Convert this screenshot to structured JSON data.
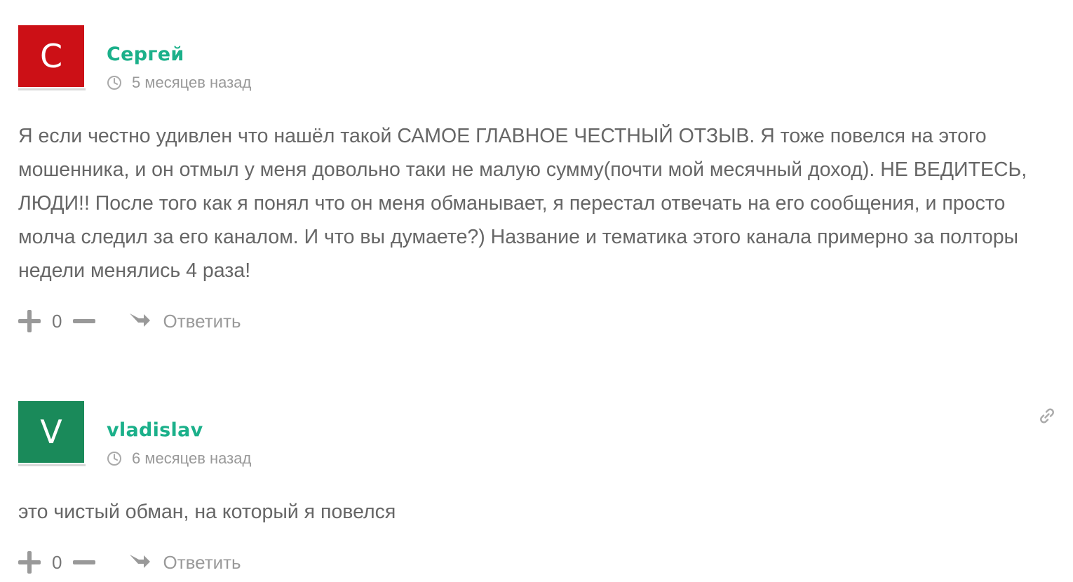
{
  "comments": [
    {
      "avatar_letter": "С",
      "avatar_color": "#cc1016",
      "author": "Сергей",
      "time": "5 месяцев назад",
      "text": "Я если честно удивлен что нашёл такой САМОЕ ГЛАВНОЕ ЧЕСТНЫЙ ОТЗЫВ. Я тоже повелся на этого мошенника, и он отмыл у меня довольно таки не малую сумму(почти мой месячный доход). НЕ ВЕДИТЕСЬ, ЛЮДИ!! После того как я понял что он меня обманывает, я перестал отвечать на его сообщения, и просто молча следил за его каналом. И что вы думаете?) Название и тематика этого канала примерно за полторы недели менялись 4 раза!",
      "votes": "0",
      "reply_label": "Ответить"
    },
    {
      "avatar_letter": "V",
      "avatar_color": "#1a8a5a",
      "author": "vladislav",
      "time": "6 месяцев назад",
      "text": "это чистый обман, на который я повелся",
      "votes": "0",
      "reply_label": "Ответить",
      "has_link_icon": true
    }
  ],
  "colors": {
    "author": "#1bb08a",
    "meta": "#999999",
    "text": "#666666"
  }
}
